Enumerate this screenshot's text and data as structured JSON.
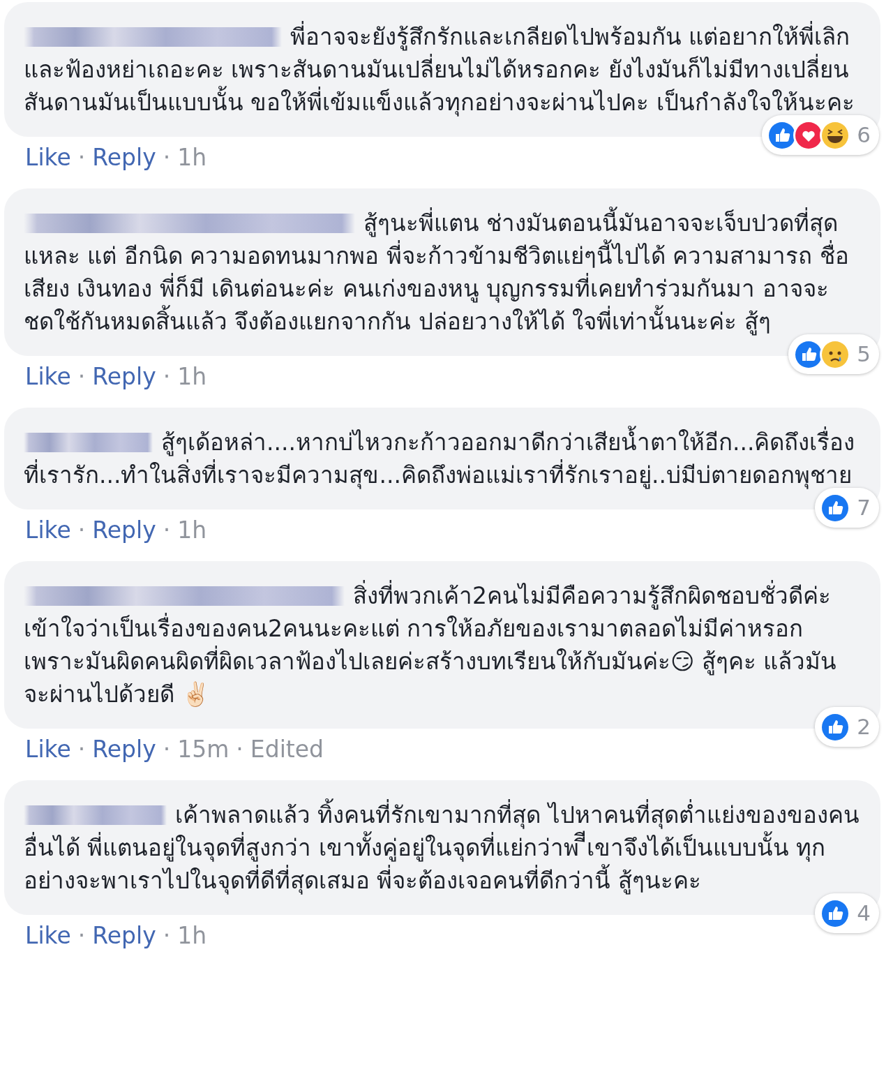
{
  "comments": [
    {
      "text": "พี่อาจจะยังรู้สึกรักและเกลียดไปพร้อมกัน แต่อยากให้พี่เลิกและฟ้องหย่าเถอะคะ เพราะสันดานมันเปลี่ยนไม่ได้หรอกคะ ยังไงมันก็ไม่มีทางเปลี่ยน สันดานมันเป็นแบบนั้น ขอให้พี่เข้มแข็งแล้วทุกอย่างจะผ่านไปคะ เป็นกำลังใจให้นะคะ",
      "reactions": [
        {
          "kind": "like"
        },
        {
          "kind": "love"
        },
        {
          "kind": "haha"
        }
      ],
      "reaction_count": "6",
      "meta": [
        {
          "kind": "link",
          "text": "Like"
        },
        {
          "kind": "dot",
          "text": "·"
        },
        {
          "kind": "link",
          "text": "Reply"
        },
        {
          "kind": "dot",
          "text": "·"
        },
        {
          "kind": "time",
          "text": "1h"
        }
      ]
    },
    {
      "text": "สู้ๆนะพี่แตน ช่างมันตอนนี้มันอาจจะเจ็บปวดที่สุดแหละ แต่ อีกนิด ความอดทนมากพอ พี่จะก้าวข้ามชีวิตแย่ๆนี้ไปได้ ความสามารถ ชื่อเสียง เงินทอง พี่ก็มี เดินต่อนะค่ะ คนเก่งของหนู บุญกรรมที่เคยทำร่วมกันมา อาจจะชดใช้กันหมดสิ้นแล้ว จึงต้องแยกจากกัน ปล่อยวางให้ได้ ใจพี่เท่านั้นนะค่ะ สู้ๆ",
      "reactions": [
        {
          "kind": "like"
        },
        {
          "kind": "sad"
        }
      ],
      "reaction_count": "5",
      "meta": [
        {
          "kind": "link",
          "text": "Like"
        },
        {
          "kind": "dot",
          "text": "·"
        },
        {
          "kind": "link",
          "text": "Reply"
        },
        {
          "kind": "dot",
          "text": "·"
        },
        {
          "kind": "time",
          "text": "1h"
        }
      ]
    },
    {
      "text": "สู้ๆเด้อหล่า....หากบ่ไหวกะก้าวออกมาดีกว่าเสียน้ำตาให้อีก...คิดถึงเรื่องที่เรารัก...ทำในสิ่งที่เราจะมีความสุข...คิดถึงพ่อแม่เราที่รักเราอยู่..บ่มีบ่ตายดอกพุชาย",
      "reactions": [
        {
          "kind": "like"
        }
      ],
      "reaction_count": "7",
      "meta": [
        {
          "kind": "link",
          "text": "Like"
        },
        {
          "kind": "dot",
          "text": "·"
        },
        {
          "kind": "link",
          "text": "Reply"
        },
        {
          "kind": "dot",
          "text": "·"
        },
        {
          "kind": "time",
          "text": "1h"
        }
      ]
    },
    {
      "text": "สิ่งที่พวกเค้า2คนไม่มีคือความรู้สึกผิดชอบชั่วดีค่ะ เข้าใจว่าเป็นเรื่องของคน2คนนะคะแต่ การให้อภัยของเรามาตลอดไม่มีค่าหรอก เพราะมันผิดคนผิดที่ผิดเวลาฟ้องไปเลยค่ะสร้างบทเรียนให้กับมันค่ะ😏 สู้ๆคะ แล้วมันจะผ่านไปด้วยดี ✌🏻",
      "reactions": [
        {
          "kind": "like"
        }
      ],
      "reaction_count": "2",
      "meta": [
        {
          "kind": "link",
          "text": "Like"
        },
        {
          "kind": "dot",
          "text": "·"
        },
        {
          "kind": "link",
          "text": "Reply"
        },
        {
          "kind": "dot",
          "text": "·"
        },
        {
          "kind": "time",
          "text": "15m"
        },
        {
          "kind": "dot",
          "text": "·"
        },
        {
          "kind": "time",
          "text": "Edited"
        }
      ]
    },
    {
      "text": "เค้าพลาดแล้ว ทิ้งคนที่รักเขามากที่สุด ไปหาคนที่สุดต่ำแย่งของของคนอื่นได้ พี่แตนอยู่ในจุดที่สูงกว่า เขาทั้งคู่อยู่ในจุดที่แย่กว่าพ ีีเขาจึงได้เป็นแบบนั้น ทุกอย่างจะพาเราไปในจุดที่ดีที่สุดเสมอ พี่จะต้องเจอคนที่ดีกว่านี้ สู้ๆนะคะ",
      "reactions": [
        {
          "kind": "like"
        }
      ],
      "reaction_count": "4",
      "meta": [
        {
          "kind": "link",
          "text": "Like"
        },
        {
          "kind": "dot",
          "text": "·"
        },
        {
          "kind": "link",
          "text": "Reply"
        },
        {
          "kind": "dot",
          "text": "·"
        },
        {
          "kind": "time",
          "text": "1h"
        }
      ]
    }
  ]
}
